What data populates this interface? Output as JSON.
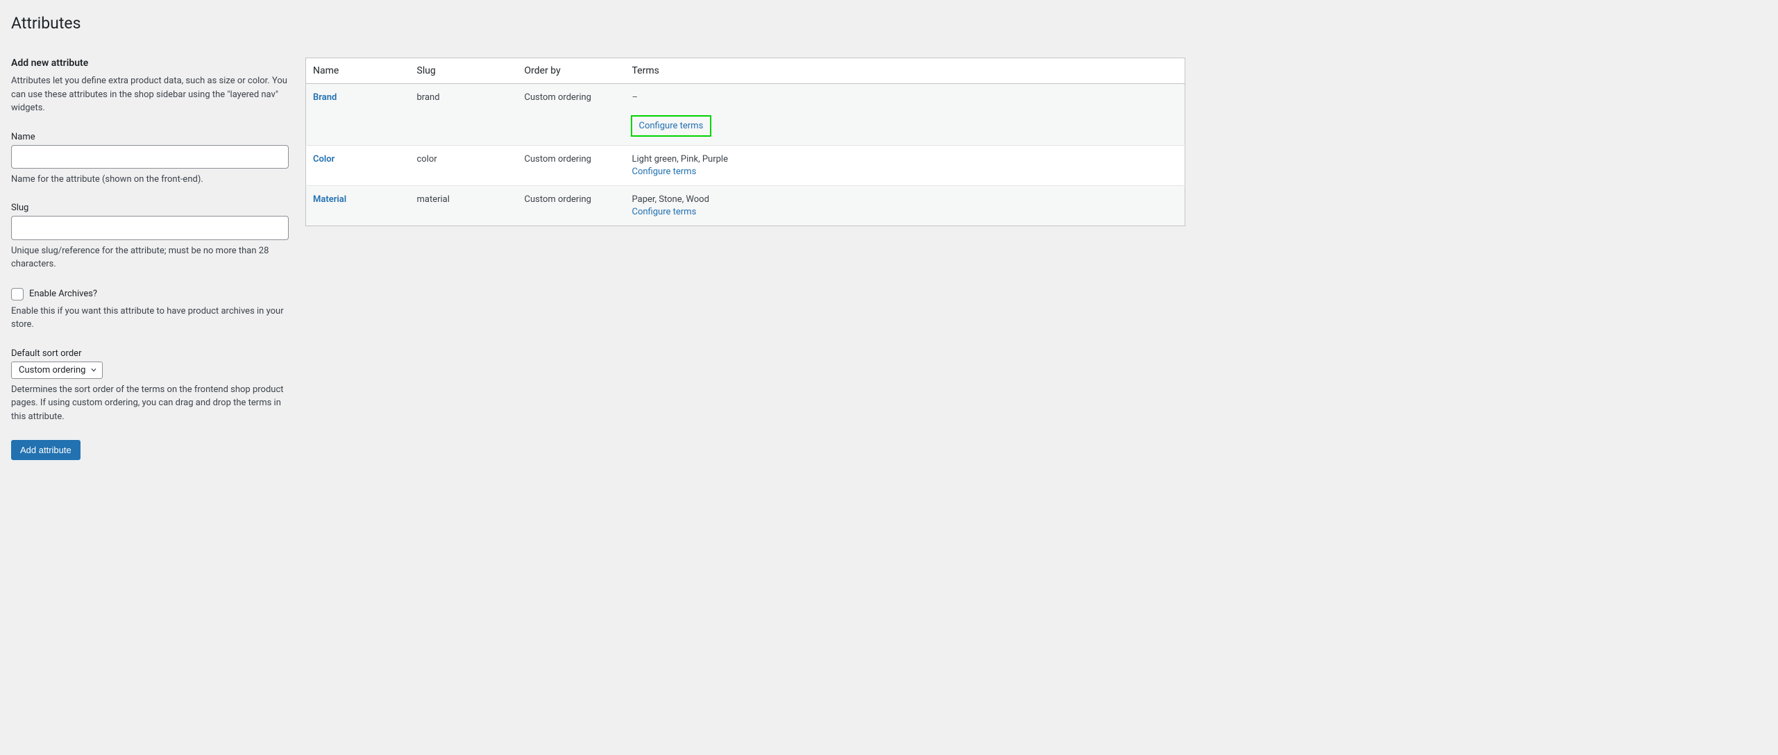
{
  "page_title": "Attributes",
  "form": {
    "heading": "Add new attribute",
    "intro": "Attributes let you define extra product data, such as size or color. You can use these attributes in the shop sidebar using the \"layered nav\" widgets.",
    "name_label": "Name",
    "name_value": "",
    "name_desc": "Name for the attribute (shown on the front-end).",
    "slug_label": "Slug",
    "slug_value": "",
    "slug_desc": "Unique slug/reference for the attribute; must be no more than 28 characters.",
    "archives_label": "Enable Archives?",
    "archives_desc": "Enable this if you want this attribute to have product archives in your store.",
    "sort_label": "Default sort order",
    "sort_value": "Custom ordering",
    "sort_desc": "Determines the sort order of the terms on the frontend shop product pages. If using custom ordering, you can drag and drop the terms in this attribute.",
    "submit_label": "Add attribute"
  },
  "table": {
    "columns": {
      "name": "Name",
      "slug": "Slug",
      "order": "Order by",
      "terms": "Terms"
    },
    "configure_label": "Configure terms",
    "rows": [
      {
        "name": "Brand",
        "slug": "brand",
        "order": "Custom ordering",
        "terms": "–",
        "highlight": true
      },
      {
        "name": "Color",
        "slug": "color",
        "order": "Custom ordering",
        "terms": "Light green, Pink, Purple"
      },
      {
        "name": "Material",
        "slug": "material",
        "order": "Custom ordering",
        "terms": "Paper, Stone, Wood"
      }
    ]
  }
}
